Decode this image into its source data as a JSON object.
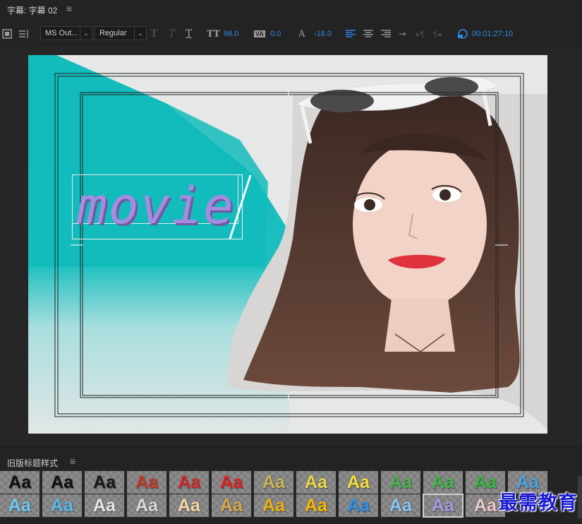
{
  "panel": {
    "title": "字幕: 字幕 02",
    "menu_glyph": "≡"
  },
  "toolbar": {
    "font_family": "MS Out...",
    "font_style": "Regular",
    "font_size": "98.0",
    "kerning": "0.0",
    "leading": "-16.0",
    "timecode": "00:01:27:10",
    "bold_glyph": "T",
    "italic_glyph": "T",
    "underline_glyph": "T",
    "size_glyph": "TT",
    "kern_glyph": "VA",
    "lead_glyph": "A",
    "tab_glyph": "⇥",
    "dropdown_arrow": "⌄"
  },
  "canvas": {
    "text": "movie"
  },
  "styles_panel": {
    "title": "旧版标题样式",
    "menu_glyph": "≡",
    "row1": [
      {
        "label": "Aa",
        "color": "#111111"
      },
      {
        "label": "Aa",
        "color": "#111111"
      },
      {
        "label": "Aa",
        "color": "#1a1a1a"
      },
      {
        "label": "Aa",
        "color": "#c0392b"
      },
      {
        "label": "Aa",
        "color": "#d0282a"
      },
      {
        "label": "Aa",
        "color": "#e02020"
      },
      {
        "label": "Aa",
        "color": "#c9b458"
      },
      {
        "label": "Aa",
        "color": "#e8d84a"
      },
      {
        "label": "Aa",
        "color": "#f0dc3c"
      },
      {
        "label": "Aa",
        "color": "#4caf50"
      },
      {
        "label": "Aa",
        "color": "#43b649"
      },
      {
        "label": "Aa",
        "color": "#35b53f"
      },
      {
        "label": "Aa",
        "color": "#4aa3df"
      }
    ],
    "row2": [
      {
        "label": "Aa",
        "color": "#6fc8f0"
      },
      {
        "label": "Aa",
        "color": "#5ab8ea"
      },
      {
        "label": "Aa",
        "color": "#e6e6e6"
      },
      {
        "label": "Aa",
        "color": "#d9d9d9"
      },
      {
        "label": "Aa",
        "color": "#f2d7a6"
      },
      {
        "label": "Aa",
        "color": "#d4a94a"
      },
      {
        "label": "Aa",
        "color": "#e8b318"
      },
      {
        "label": "Aa",
        "color": "#f5b800"
      },
      {
        "label": "Aa",
        "color": "#2f8fe8"
      },
      {
        "label": "Aa",
        "color": "#8ac4f2"
      },
      {
        "label": "Aa",
        "color": "#a79ae0"
      },
      {
        "label": "Aa",
        "color": "#f0c8c8"
      }
    ]
  },
  "watermark": "最需教育"
}
